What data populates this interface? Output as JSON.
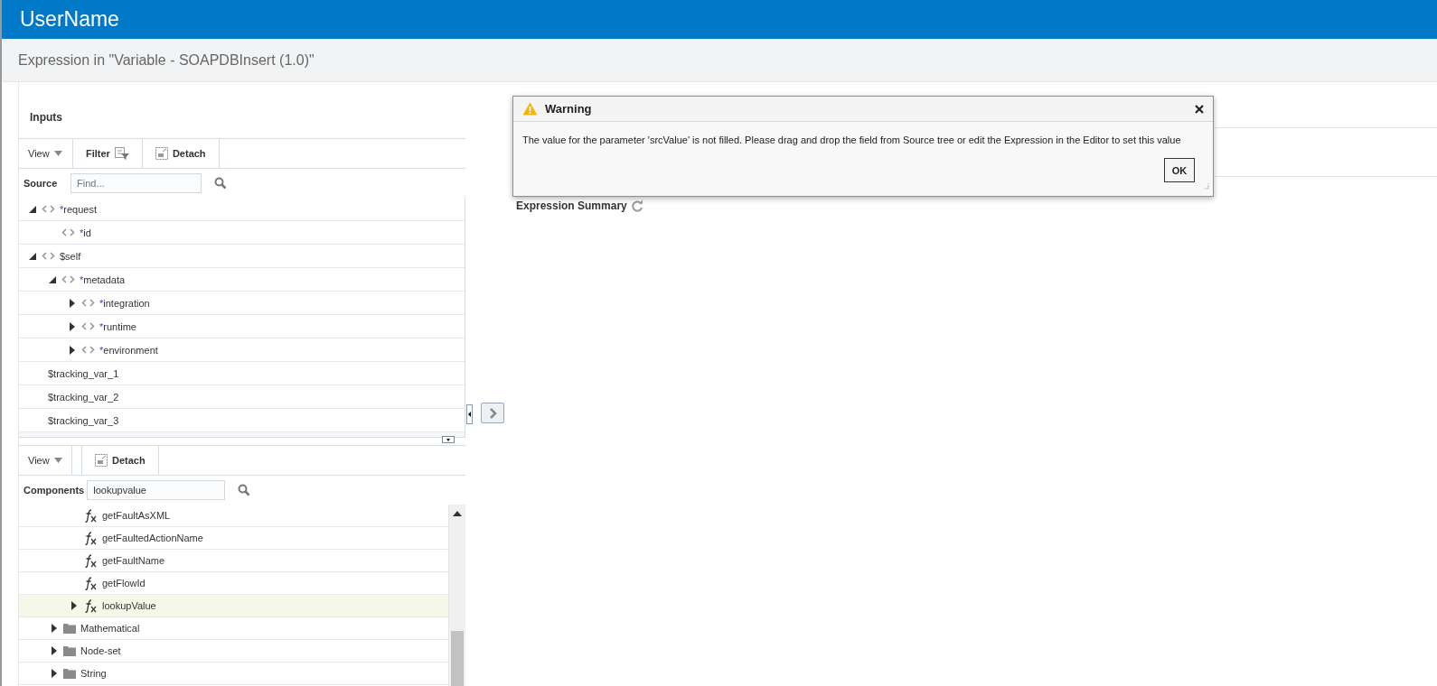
{
  "header": {
    "title": "UserName"
  },
  "page": {
    "title": "Expression in \"Variable - SOAPDBInsert (1.0)\""
  },
  "inputs": {
    "title": "Inputs",
    "toolbar": [
      {
        "kind": "menu",
        "label": "View"
      },
      {
        "kind": "filter",
        "label": "Filter"
      },
      {
        "kind": "detach",
        "label": "Detach"
      }
    ],
    "search": {
      "label": "Source",
      "placeholder": "Find..."
    },
    "tree": [
      {
        "kind": "element",
        "marker": "*",
        "name": "request",
        "expanded": true,
        "children": [
          {
            "kind": "element",
            "marker": "*",
            "name": "id"
          }
        ]
      },
      {
        "kind": "element",
        "name": "$self",
        "expanded": true,
        "children": [
          {
            "kind": "element",
            "marker": "*",
            "name": "metadata",
            "expanded": true,
            "children": [
              {
                "kind": "element",
                "marker": "*",
                "name": "integration",
                "expanded": false
              },
              {
                "kind": "element",
                "marker": "*",
                "name": "runtime",
                "expanded": false
              },
              {
                "kind": "element",
                "marker": "*",
                "name": "environment",
                "expanded": false
              }
            ]
          }
        ]
      },
      {
        "kind": "variable",
        "name": "$tracking_var_1"
      },
      {
        "kind": "variable",
        "name": "$tracking_var_2"
      },
      {
        "kind": "variable",
        "name": "$tracking_var_3"
      }
    ]
  },
  "components": {
    "toolbar": [
      {
        "kind": "menu",
        "label": "View"
      },
      {
        "kind": "detach",
        "label": "Detach"
      }
    ],
    "search": {
      "label": "Components",
      "value": "lookupvalue"
    },
    "functions": [
      {
        "name": "getFaultAsXML",
        "expandable": false,
        "selected": false
      },
      {
        "name": "getFaultedActionName",
        "expandable": false,
        "selected": false
      },
      {
        "name": "getFaultName",
        "expandable": false,
        "selected": false
      },
      {
        "name": "getFlowId",
        "expandable": false,
        "selected": false
      },
      {
        "name": "lookupValue",
        "expandable": true,
        "selected": true
      }
    ],
    "categories": [
      {
        "name": "Mathematical"
      },
      {
        "name": "Node-set"
      },
      {
        "name": "String"
      }
    ]
  },
  "summary": {
    "title": "Expression Summary"
  },
  "dialog": {
    "title": "Warning",
    "message": "The value for the parameter 'srcValue' is not filled. Please drag and drop the field from Source tree or edit the Expression in the Editor to set this value",
    "button": "OK"
  }
}
